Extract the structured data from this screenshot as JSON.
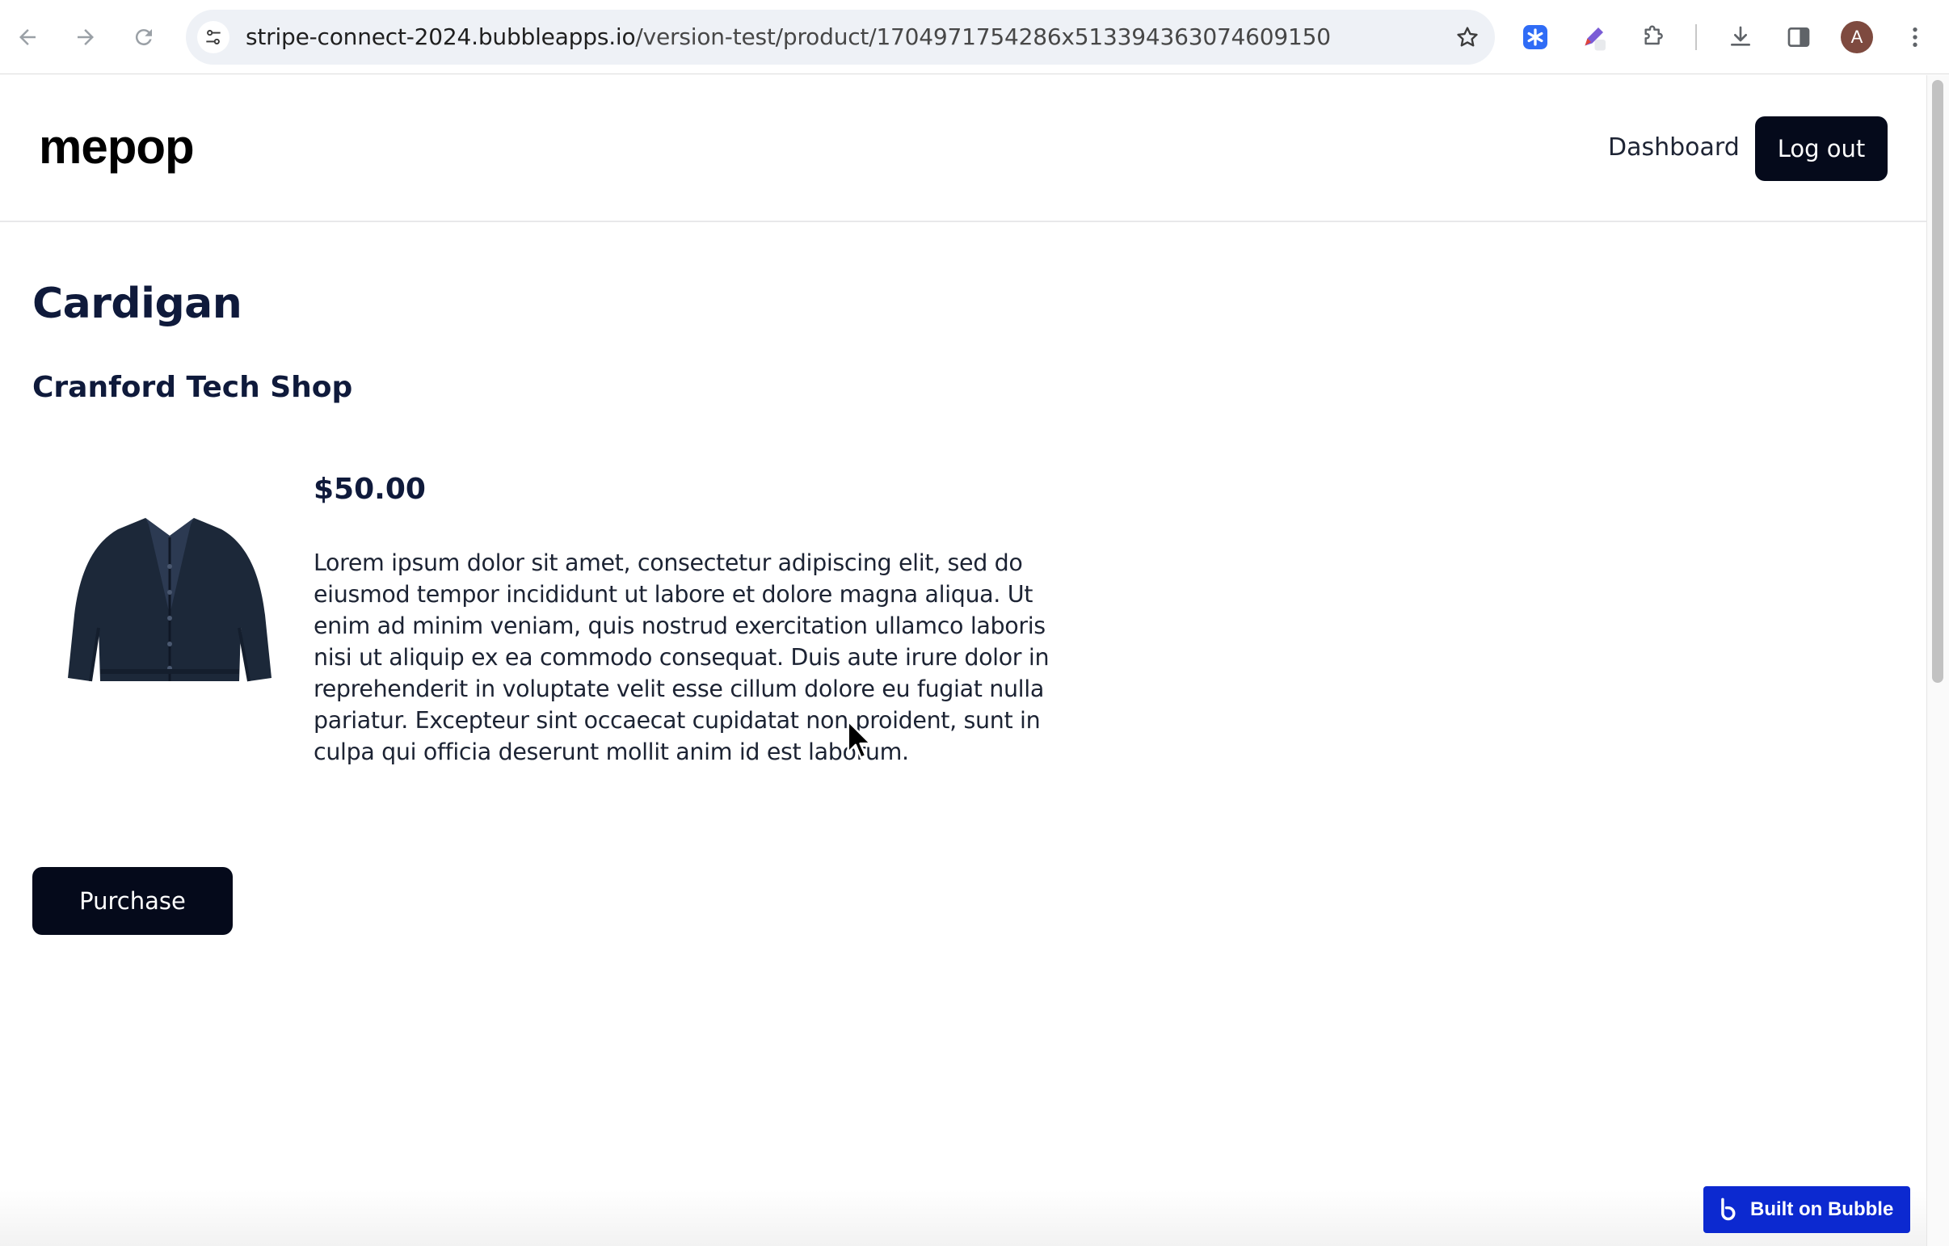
{
  "browser": {
    "url_host": "stripe-connect-2024.bubbleapps.io",
    "url_path": "/version-test/product/1704971754286x513394363074609150",
    "profile_initial": "A"
  },
  "header": {
    "logo": "mepop",
    "dashboard_label": "Dashboard",
    "logout_label": "Log out"
  },
  "product": {
    "title": "Cardigan",
    "shop": "Cranford Tech Shop",
    "price": "$50.00",
    "description": "Lorem ipsum dolor sit amet, consectetur adipiscing elit, sed do eiusmod tempor incididunt ut labore et dolore magna aliqua. Ut enim ad minim veniam, quis nostrud exercitation ullamco laboris nisi ut aliquip ex ea commodo consequat. Duis aute irure dolor in reprehenderit in voluptate velit esse cillum dolore eu fugiat nulla pariatur. Excepteur sint occaecat cupidatat non proident, sunt in culpa qui officia deserunt mollit anim id est laborum.",
    "purchase_label": "Purchase"
  },
  "badge": {
    "label": "Built on Bubble"
  },
  "colors": {
    "primary_button": "#050a1b",
    "heading": "#0f1a3b",
    "bubble_badge": "#0c29d0"
  }
}
